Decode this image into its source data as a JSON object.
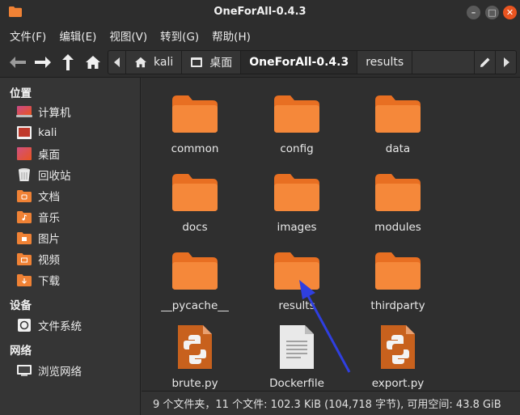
{
  "window": {
    "title": "OneForAll-0.4.3"
  },
  "menu": [
    "文件(F)",
    "编辑(E)",
    "视图(V)",
    "转到(G)",
    "帮助(H)"
  ],
  "pathbar": {
    "segments": [
      {
        "label": "kali",
        "icon": "home-icon"
      },
      {
        "label": "桌面",
        "icon": "desktop-icon"
      },
      {
        "label": "OneForAll-0.4.3",
        "icon": ""
      },
      {
        "label": "results",
        "icon": ""
      }
    ]
  },
  "sidebar": {
    "places_header": "位置",
    "places": [
      {
        "label": "计算机",
        "icon": "computer-icon"
      },
      {
        "label": "kali",
        "icon": "home-folder-icon"
      },
      {
        "label": "桌面",
        "icon": "desktop-folder-icon"
      },
      {
        "label": "回收站",
        "icon": "trash-icon"
      },
      {
        "label": "文档",
        "icon": "documents-folder-icon"
      },
      {
        "label": "音乐",
        "icon": "music-folder-icon"
      },
      {
        "label": "图片",
        "icon": "pictures-folder-icon"
      },
      {
        "label": "视频",
        "icon": "videos-folder-icon"
      },
      {
        "label": "下载",
        "icon": "downloads-folder-icon"
      }
    ],
    "devices_header": "设备",
    "devices": [
      {
        "label": "文件系统",
        "icon": "drive-icon"
      }
    ],
    "network_header": "网络",
    "network": [
      {
        "label": "浏览网络",
        "icon": "network-icon"
      }
    ]
  },
  "files": [
    {
      "name": "common",
      "type": "folder"
    },
    {
      "name": "config",
      "type": "folder"
    },
    {
      "name": "data",
      "type": "folder"
    },
    {
      "name": "docs",
      "type": "folder"
    },
    {
      "name": "images",
      "type": "folder"
    },
    {
      "name": "modules",
      "type": "folder"
    },
    {
      "name": "__pycache__",
      "type": "folder"
    },
    {
      "name": "results",
      "type": "folder"
    },
    {
      "name": "thirdparty",
      "type": "folder"
    },
    {
      "name": "brute.py",
      "type": "python"
    },
    {
      "name": "Dockerfile",
      "type": "text"
    },
    {
      "name": "export.py",
      "type": "python"
    }
  ],
  "status": "9 个文件夹，11 个文件: 102.3 KiB (104,718 字节), 可用空间: 43.8 GiB",
  "colors": {
    "folder": "#f08235",
    "accent": "#e95420",
    "pointer": "#2f3fe0"
  }
}
